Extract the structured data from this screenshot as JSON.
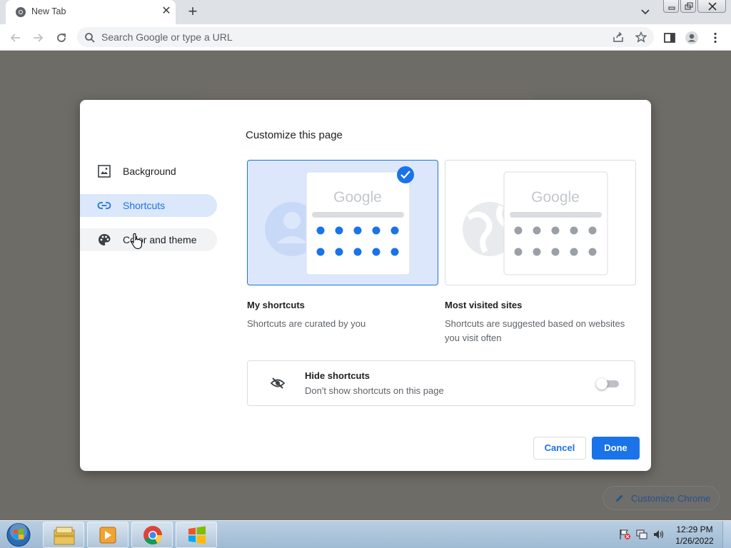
{
  "browser": {
    "tab_title": "New Tab",
    "omnibox_placeholder": "Search Google or type a URL"
  },
  "page": {
    "customize_chrome_label": "Customize Chrome"
  },
  "dialog": {
    "title": "Customize this page",
    "nav": [
      {
        "label": "Background",
        "icon": "image-icon",
        "state": "normal"
      },
      {
        "label": "Shortcuts",
        "icon": "link-icon",
        "state": "active"
      },
      {
        "label": "Color and theme",
        "icon": "palette-icon",
        "state": "hover"
      }
    ],
    "options": [
      {
        "title": "My shortcuts",
        "description": "Shortcuts are curated by you",
        "selected": true,
        "logo_text": "Google",
        "icon": "person-icon"
      },
      {
        "title": "Most visited sites",
        "description": "Shortcuts are suggested based on websites you visit often",
        "selected": false,
        "logo_text": "Google",
        "icon": "globe-icon"
      }
    ],
    "hide_shortcuts": {
      "title": "Hide shortcuts",
      "description": "Don't show shortcuts on this page",
      "enabled": false,
      "icon": "eye-off-icon"
    },
    "buttons": {
      "cancel": "Cancel",
      "done": "Done"
    }
  },
  "taskbar": {
    "time": "12:29 PM",
    "date": "1/26/2022",
    "pinned": [
      "explorer-icon",
      "media-player-icon",
      "chrome-icon",
      "windows-icon"
    ]
  },
  "colors": {
    "accent": "#1a73e8",
    "selected_card_bg": "#dde7fb",
    "overlay": "#6e6c66"
  }
}
